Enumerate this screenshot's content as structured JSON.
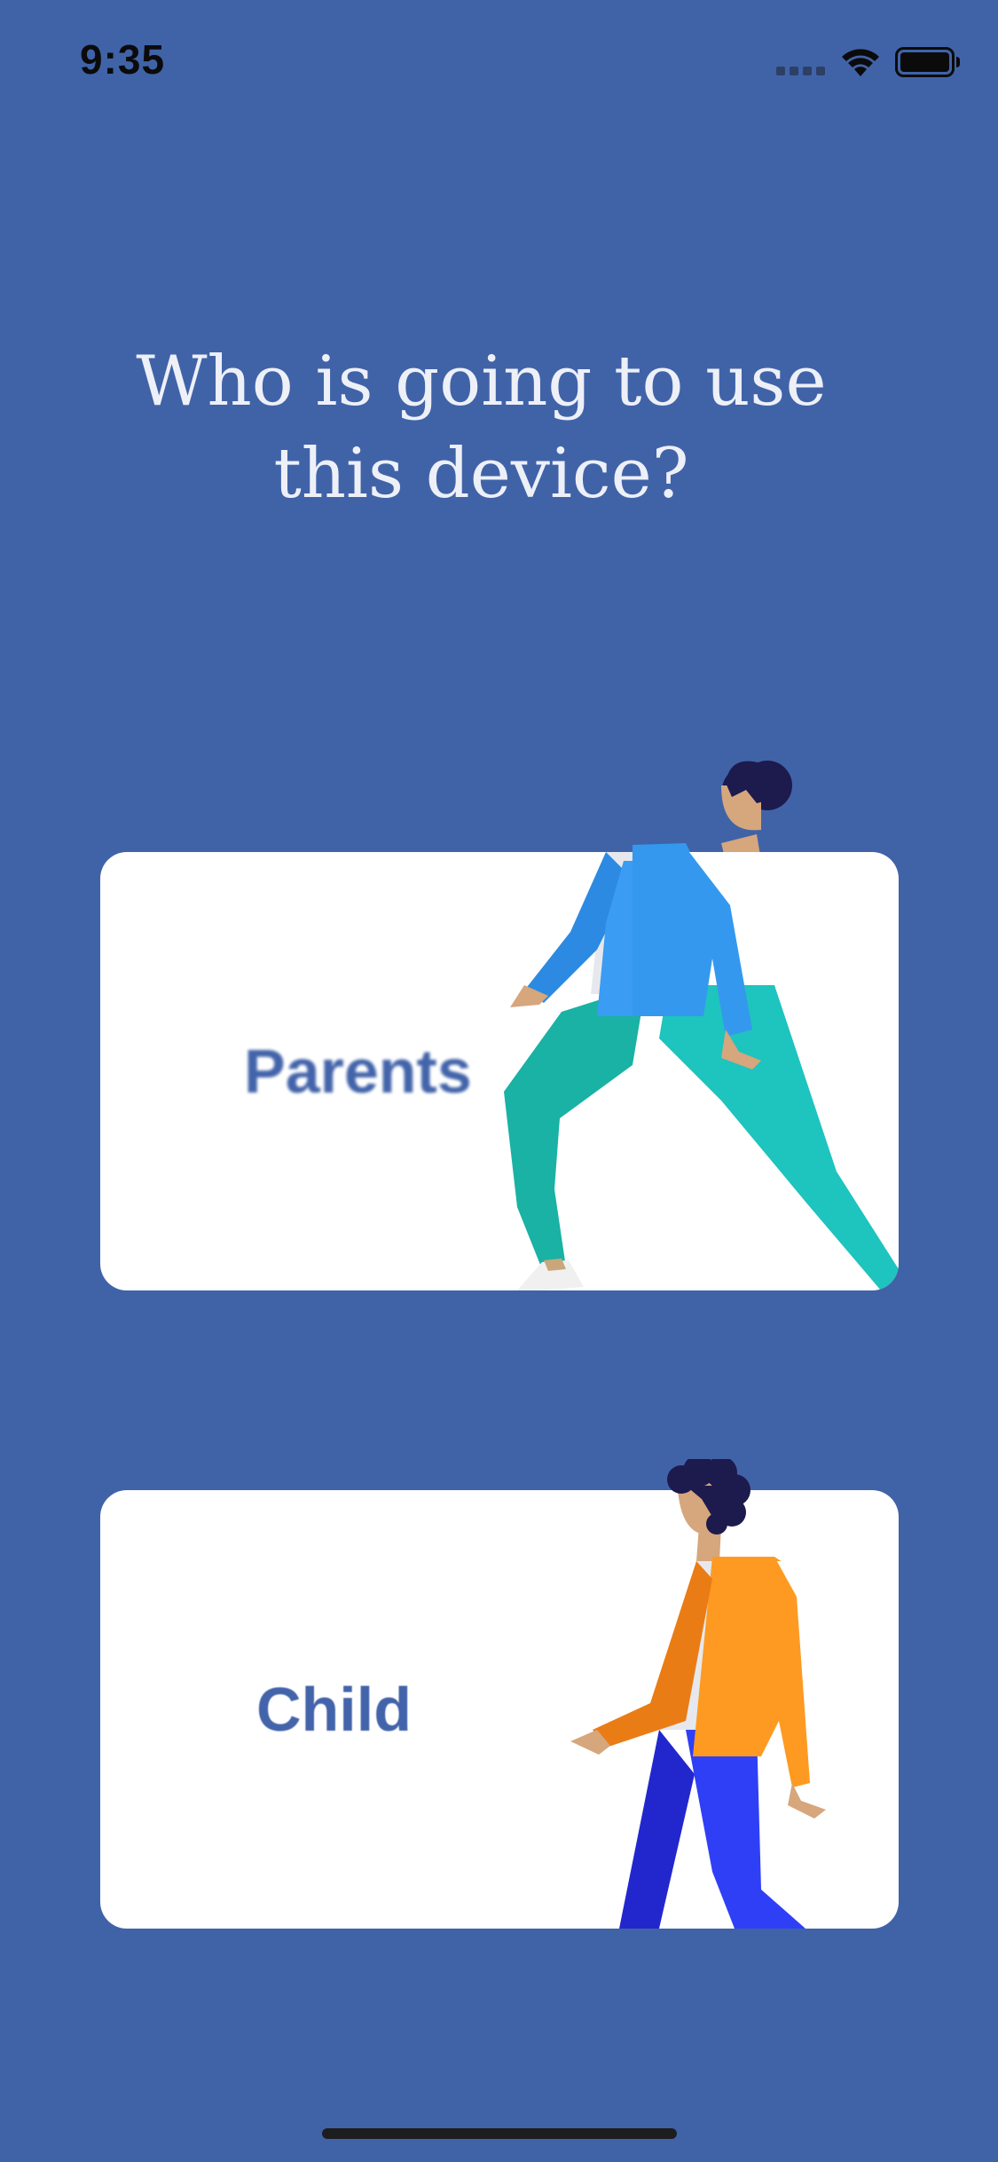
{
  "status_bar": {
    "time": "9:35",
    "icons": [
      "cellular-signal-icon",
      "wifi-icon",
      "battery-icon"
    ]
  },
  "prompt": {
    "line1": "Who is going to use",
    "line2": "this device?"
  },
  "options": {
    "parents": {
      "label": "Parents",
      "illustration": "walking-woman-illustration"
    },
    "child": {
      "label": "Child",
      "illustration": "walking-child-illustration"
    }
  },
  "colors": {
    "background": "#4063a8",
    "card": "#ffffff",
    "label": "#4364aa",
    "title": "#eef0f8"
  }
}
